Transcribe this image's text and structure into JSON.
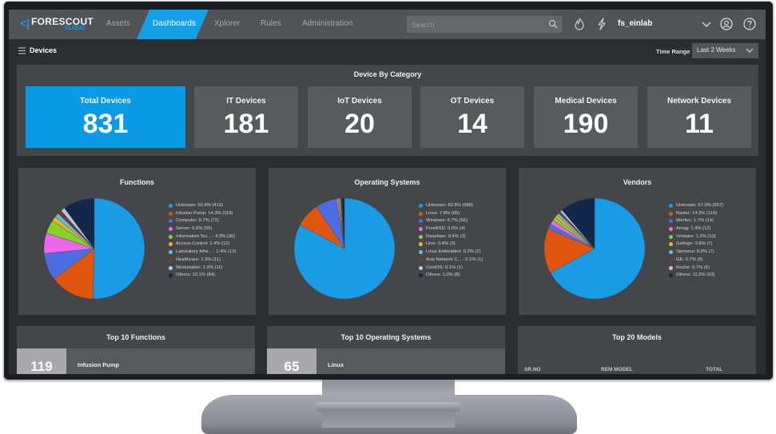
{
  "app": {
    "logo_text": "FORESCOUT",
    "logo_sub": "CLOUD",
    "logo_icon": "forescout-chevron-logo"
  },
  "nav": {
    "items": [
      {
        "label": "Assets",
        "active": false
      },
      {
        "label": "Dashboards",
        "active": true
      },
      {
        "label": "Xplorer",
        "active": false
      },
      {
        "label": "Rules",
        "active": false
      },
      {
        "label": "Administration",
        "active": false
      }
    ],
    "search_placeholder": "Search",
    "search_value": "",
    "icons": [
      "flame-icon",
      "lightning-icon",
      "chevron-down-icon",
      "user-circle-icon",
      "help-circle-icon"
    ],
    "user": "fs_einlab",
    "accent_color": "#16a0e8"
  },
  "subheader": {
    "title": "Devices",
    "time_range_label": "Time Range",
    "time_range_value": "Last 2 Weeks"
  },
  "category": {
    "title": "Device By Category",
    "tiles": [
      {
        "label": "Total Devices",
        "value": "831",
        "active": true
      },
      {
        "label": "IT Devices",
        "value": "181"
      },
      {
        "label": "IoT Devices",
        "value": "20"
      },
      {
        "label": "OT Devices",
        "value": "14"
      },
      {
        "label": "Medical Devices",
        "value": "190"
      },
      {
        "label": "Network Devices",
        "value": "11"
      }
    ]
  },
  "chart_data": [
    {
      "type": "pie",
      "title": "Functions",
      "legend_placement": "right",
      "start_angle": "12 o'clock, clockwise",
      "slices": [
        {
          "label": "Unknown: 50.4% (419)",
          "name": "Unknown",
          "value": 419,
          "percent": 50.4,
          "color": "#1a9be6"
        },
        {
          "label": "Infusion Pump: 14.3% (119)",
          "name": "Infusion Pump",
          "value": 119,
          "percent": 14.3,
          "color": "#e0560f"
        },
        {
          "label": "Computer: 8.7% (72)",
          "name": "Computer",
          "value": 72,
          "percent": 8.7,
          "color": "#4d6ee3"
        },
        {
          "label": "Server: 6.6% (55)",
          "name": "Server",
          "value": 55,
          "percent": 6.6,
          "color": "#ee66ea"
        },
        {
          "label": "Information Tec... : 4.3% (36)",
          "name": "Information Tec...",
          "value": 36,
          "percent": 4.3,
          "color": "#80d42a"
        },
        {
          "label": "Access Control: 1.4% (12)",
          "name": "Access Control",
          "value": 12,
          "percent": 1.4,
          "color": "#f3b221"
        },
        {
          "label": "Laboratory Infor... : 1.4% (12)",
          "name": "Laboratory Infor...",
          "value": 12,
          "percent": 1.4,
          "color": "#56bfe9"
        },
        {
          "label": "Healthcare: 1.3% (11)",
          "name": "Healthcare",
          "value": 11,
          "percent": 1.3,
          "color": "#7b3b2a"
        },
        {
          "label": "Workstation: 1.3% (11)",
          "name": "Workstation",
          "value": 11,
          "percent": 1.3,
          "color": "#b4c6ea"
        },
        {
          "label": "Others: 10.1% (84)",
          "name": "Others",
          "value": 84,
          "percent": 10.1,
          "color": "#12284a"
        }
      ]
    },
    {
      "type": "pie",
      "title": "Operating Systems",
      "legend_placement": "right",
      "start_angle": "12 o'clock, clockwise",
      "slices": [
        {
          "label": "Unknown: 82.8% (688)",
          "name": "Unknown",
          "value": 688,
          "percent": 82.8,
          "color": "#1a9be6"
        },
        {
          "label": "Linux: 7.8% (65)",
          "name": "Linux",
          "value": 65,
          "percent": 7.8,
          "color": "#e0560f"
        },
        {
          "label": "Windows: 6.7% (56)",
          "name": "Windows",
          "value": 56,
          "percent": 6.7,
          "color": "#4d6ee3"
        },
        {
          "label": "FreeBSD: 0.5% (4)",
          "name": "FreeBSD",
          "value": 4,
          "percent": 0.5,
          "color": "#ee66ea"
        },
        {
          "label": "Raspbian: 0.4% (3)",
          "name": "Raspbian",
          "value": 3,
          "percent": 0.4,
          "color": "#80d42a"
        },
        {
          "label": "Unix: 0.4% (3)",
          "name": "Unix",
          "value": 3,
          "percent": 0.4,
          "color": "#f3b221"
        },
        {
          "label": "Linux Embedded: 0.2% (2)",
          "name": "Linux Embedded",
          "value": 2,
          "percent": 0.2,
          "color": "#56bfe9"
        },
        {
          "label": "Axis Network C... : 0.1% (1)",
          "name": "Axis Network C...",
          "value": 1,
          "percent": 0.1,
          "color": "#7b3b2a"
        },
        {
          "label": "CentOS: 0.1% (1)",
          "name": "CentOS",
          "value": 1,
          "percent": 0.1,
          "color": "#b4c6ea"
        },
        {
          "label": "Others: 1.0% (8)",
          "name": "Others",
          "value": 8,
          "percent": 1.0,
          "color": "#12284a"
        }
      ]
    },
    {
      "type": "pie",
      "title": "Vendors",
      "legend_placement": "right",
      "start_angle": "12 o'clock, clockwise",
      "slices": [
        {
          "label": "Unknown: 67.0% (557)",
          "name": "Unknown",
          "value": 557,
          "percent": 67.0,
          "color": "#1a9be6"
        },
        {
          "label": "Baxter: 14.3% (119)",
          "name": "Baxter",
          "value": 119,
          "percent": 14.3,
          "color": "#e0560f"
        },
        {
          "label": "Werfen: 1.7% (14)",
          "name": "Werfen",
          "value": 14,
          "percent": 1.7,
          "color": "#4d6ee3"
        },
        {
          "label": "Amag: 1.4% (12)",
          "name": "Amag",
          "value": 12,
          "percent": 1.4,
          "color": "#ee66ea"
        },
        {
          "label": "Vmware: 1.2% (10)",
          "name": "Vmware",
          "value": 10,
          "percent": 1.2,
          "color": "#80d42a"
        },
        {
          "label": "Getinge: 0.8% (7)",
          "name": "Getinge",
          "value": 7,
          "percent": 0.8,
          "color": "#f3b221"
        },
        {
          "label": "Siemens: 0.8% (7)",
          "name": "Siemens",
          "value": 7,
          "percent": 0.8,
          "color": "#56bfe9"
        },
        {
          "label": "GE: 0.7% (6)",
          "name": "GE",
          "value": 6,
          "percent": 0.7,
          "color": "#7b3b2a"
        },
        {
          "label": "Roche: 0.7% (6)",
          "name": "Roche",
          "value": 6,
          "percent": 0.7,
          "color": "#b4c6ea"
        },
        {
          "label": "Others: 11.2% (93)",
          "name": "Others",
          "value": 93,
          "percent": 11.2,
          "color": "#12284a"
        }
      ]
    }
  ],
  "bottom": {
    "top_functions": {
      "title": "Top 10 Functions",
      "rows": [
        {
          "count": "119",
          "label": "Infusion Pump"
        }
      ]
    },
    "top_os": {
      "title": "Top 10 Operating Systems",
      "rows": [
        {
          "count": "65",
          "label": "Linux"
        }
      ]
    },
    "top_models": {
      "title": "Top 20 Models",
      "columns": [
        "SR.NO",
        "REM MODEL",
        "TOTAL"
      ]
    }
  }
}
